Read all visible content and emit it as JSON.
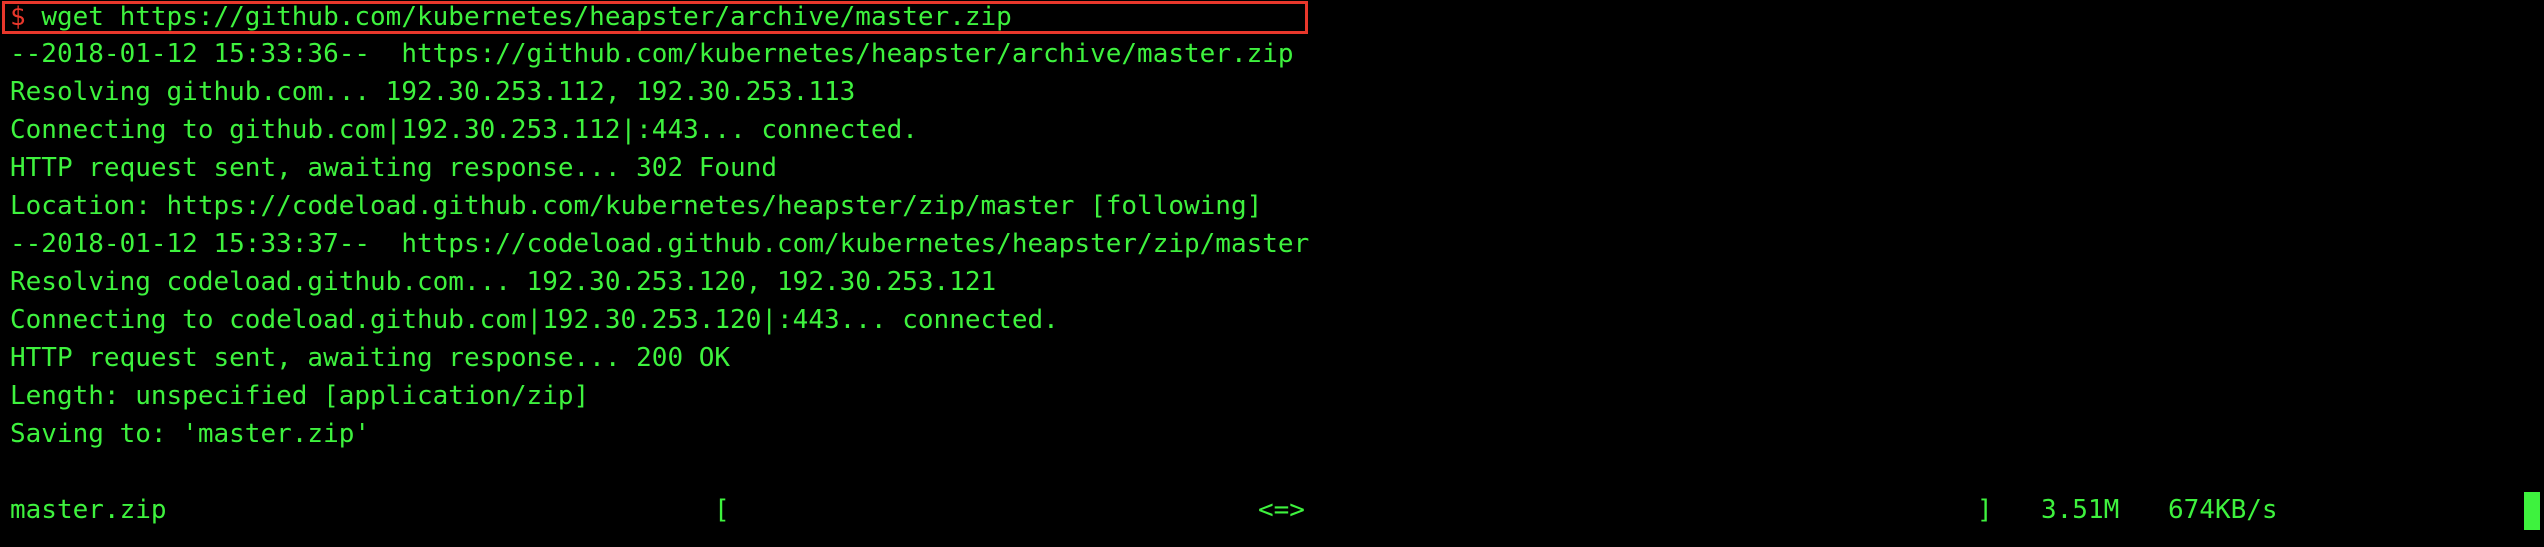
{
  "colors": {
    "background": "#000000",
    "text": "#3ef23e",
    "highlight_box": "#e8372b"
  },
  "command": {
    "prompt": "$",
    "text": "wget https://github.com/kubernetes/heapster/archive/master.zip"
  },
  "output_lines": [
    "--2018-01-12 15:33:36--  https://github.com/kubernetes/heapster/archive/master.zip",
    "Resolving github.com... 192.30.253.112, 192.30.253.113",
    "Connecting to github.com|192.30.253.112|:443... connected.",
    "HTTP request sent, awaiting response... 302 Found",
    "Location: https://codeload.github.com/kubernetes/heapster/zip/master [following]",
    "--2018-01-12 15:33:37--  https://codeload.github.com/kubernetes/heapster/zip/master",
    "Resolving codeload.github.com... 192.30.253.120, 192.30.253.121",
    "Connecting to codeload.github.com|192.30.253.120|:443... connected.",
    "HTTP request sent, awaiting response... 200 OK",
    "Length: unspecified [application/zip]",
    "Saving to: 'master.zip'"
  ],
  "progress": {
    "filename": "master.zip",
    "bracket_open": "[",
    "indicator": "<=>",
    "bracket_close": "]",
    "size": "3.51M",
    "rate": "674KB/s"
  }
}
